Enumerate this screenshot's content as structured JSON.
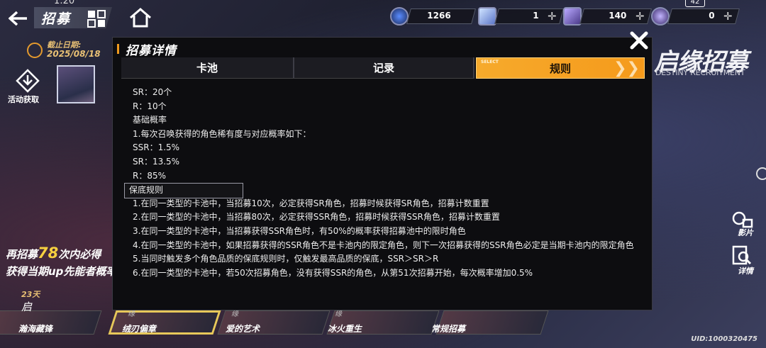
{
  "status": {
    "time": "1:20",
    "battery": "42"
  },
  "topbar": {
    "title": "招募",
    "currencies": [
      {
        "icon": "orb-icon",
        "value": "1266"
      },
      {
        "icon": "ticket-icon",
        "value": "1"
      },
      {
        "icon": "crystal-icon",
        "value": "140"
      },
      {
        "icon": "star-coin-icon",
        "value": "0"
      }
    ]
  },
  "left": {
    "deadline_label": "截止日期:",
    "deadline_date": "2025/08/18",
    "activity_label": "活动获取",
    "promo_prefix": "再招募",
    "promo_count": "78",
    "promo_suffix": "次内必得",
    "promo_line2": "获得当期up先能者概率",
    "days": "23天"
  },
  "bottom_tabs": [
    {
      "small": "启",
      "label": "瀚海藏锋"
    },
    {
      "small": "缘",
      "label": "绒刃偏章"
    },
    {
      "small": "缘",
      "label": "爱的艺术"
    },
    {
      "small": "缘",
      "label": "冰火重生"
    },
    {
      "small": "",
      "label": "常规招募"
    }
  ],
  "uid": "UID:1000320475",
  "right": {
    "logo": "启缘招募",
    "logo_sub": "DESTINY RECRUITMENT",
    "film_label": "影片",
    "details_label": "详情"
  },
  "modal": {
    "title": "招募详情",
    "tabs": [
      {
        "label": "卡池"
      },
      {
        "label": "记录"
      },
      {
        "label": "规则",
        "tag": "SELECT"
      }
    ],
    "lines": [
      "SR：20个",
      "R：10个",
      "基础概率",
      "1.每次召唤获得的角色稀有度与对应概率如下：",
      "SSR：1.5%",
      "SR：13.5%",
      "R：85%"
    ],
    "guarantee_heading": "保底规则",
    "rules": [
      "1.在同一类型的卡池中，当招募10次，必定获得SR角色，招募时候获得SR角色，招募计数重置",
      "2.在同一类型的卡池中，当招募80次，必定获得SSR角色，招募时候获得SSR角色，招募计数重置",
      "3.在同一类型的卡池中，当招募获得SSR角色时，有50%的概率获得招募池中的限时角色",
      "4.在同一类型的卡池中，如果招募获得的SSR角色不是卡池内的限定角色，则下一次招募获得的SSR角色必定是当期卡池内的限定角色",
      "5.当同时触发多个角色品质的保底规则时，仅触发最高品质的保底，SSR＞SR＞R",
      "6.在同一类型的卡池中，若50次招募角色，没有获得SSR的角色，从第51次招募开始，每次概率增加0.5%"
    ]
  },
  "colors": {
    "accent": "#f59a1b",
    "gold": "#f6d040",
    "panel": "#0d0d10"
  }
}
